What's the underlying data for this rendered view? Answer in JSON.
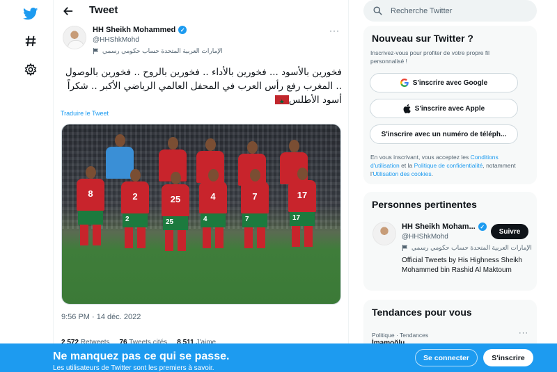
{
  "colors": {
    "accent": "#1d9bf0",
    "text": "#0f1419",
    "muted": "#536471",
    "card_bg": "#f7f9f9"
  },
  "nav": {
    "icons": [
      "twitter-logo-icon",
      "hashtag-icon",
      "gear-icon"
    ]
  },
  "header": {
    "title": "Tweet"
  },
  "tweet": {
    "author_name": "HH Sheikh Mohammed",
    "handle": "@HHShkMohd",
    "label": "الإمارات العربية المتحدة حساب حكومي رسمي",
    "text": "فخورين بالأسود ... فخورين بالأداء .. فخورين بالروح .. فخورين بالوصول .. المغرب رفع رأس العرب في المحفل العالمي الرياضي الأكبر .. شكراً أسود الأطلس",
    "translate": "Traduire le Tweet",
    "more": "···",
    "timestamp": "9:56 PM · 14 déc. 2022",
    "stats": [
      {
        "count": "2 572",
        "label": "Retweets"
      },
      {
        "count": "76",
        "label": "Tweets cités"
      },
      {
        "count": "8 511",
        "label": "J'aime"
      }
    ]
  },
  "photo": {
    "shirt_numbers": [
      "8",
      "2",
      "25",
      "4",
      "7",
      "17"
    ],
    "short_numbers": [
      "2",
      "25",
      "4",
      "7",
      "17"
    ]
  },
  "search": {
    "placeholder": "Recherche Twitter"
  },
  "signup_card": {
    "title": "Nouveau sur Twitter ?",
    "subtitle": "Inscrivez-vous pour profiter de votre propre fil personnalisé !",
    "google": "S'inscrire avec Google",
    "apple": "S'inscrire avec Apple",
    "phone": "S'inscrire avec un numéro de téléph...",
    "legal_1": "En vous inscrivant, vous acceptez les ",
    "legal_link_1": "Conditions d'utilisation",
    "legal_2": " et la ",
    "legal_link_2": "Politique de confidentialité",
    "legal_3": ", notamment l'",
    "legal_link_3": "Utilisation des cookies",
    "legal_4": "."
  },
  "relevant": {
    "title": "Personnes pertinentes",
    "name": "HH Sheikh Moham...",
    "handle": "@HHShkMohd",
    "follow": "Suivre",
    "label": "الإمارات العربية المتحدة حساب حكومي رسمي",
    "bio": "Official Tweets by His Highness Sheikh Mohammed bin Rashid Al Maktoum"
  },
  "trends": {
    "title": "Tendances pour vous",
    "meta": "Politique · Tendances",
    "name": "İmamoğlu",
    "more": "···"
  },
  "banner": {
    "title": "Ne manquez pas ce qui se passe.",
    "subtitle": "Les utilisateurs de Twitter sont les premiers à savoir.",
    "login": "Se connecter",
    "signup": "S'inscrire"
  }
}
